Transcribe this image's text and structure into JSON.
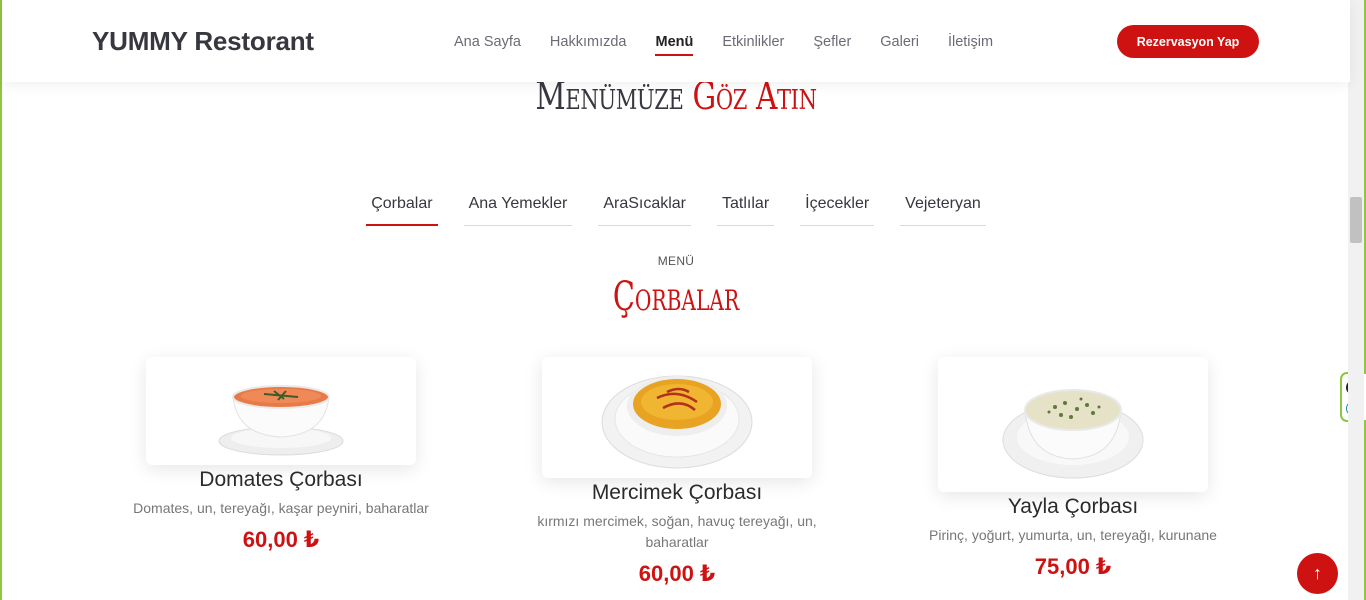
{
  "header": {
    "brand": "YUMMY Restorant",
    "nav": [
      {
        "label": "Ana Sayfa"
      },
      {
        "label": "Hakkımızda"
      },
      {
        "label": "Menü"
      },
      {
        "label": "Etkinlikler"
      },
      {
        "label": "Şefler"
      },
      {
        "label": "Galeri"
      },
      {
        "label": "İletişim"
      }
    ],
    "active_nav": "Menü",
    "cta_label": "Rezervasyon Yap"
  },
  "section": {
    "title_main": "Menümüze",
    "title_accent": "Göz Atın"
  },
  "tabs": [
    {
      "label": "Çorbalar"
    },
    {
      "label": "Ana Yemekler"
    },
    {
      "label": "AraSıcaklar"
    },
    {
      "label": "Tatlılar"
    },
    {
      "label": "İçecekler"
    },
    {
      "label": "Vejeteryan"
    }
  ],
  "active_tab": "Çorbalar",
  "category": {
    "subtitle": "MENÜ",
    "title": "Çorbalar"
  },
  "items": [
    {
      "name": "Domates Çorbası",
      "desc": "Domates, un, tereyağı, kaşar peyniri, baharatlar",
      "price": "60,00 ₺"
    },
    {
      "name": "Mercimek Çorbası",
      "desc": "kırmızı mercimek, soğan, havuç tereyağı, un, baharatlar",
      "price": "60,00 ₺"
    },
    {
      "name": "Yayla Çorbası",
      "desc": "Pirinç, yoğurt, yumurta, un, tereyağı, kurunane",
      "price": "75,00 ₺"
    }
  ],
  "widget": {
    "close_icon": "×",
    "extension_icon": "e"
  },
  "scroll_top_icon": "↑",
  "colors": {
    "accent": "#ce1212",
    "text": "#37373f",
    "widget_border": "#8dc63f"
  }
}
